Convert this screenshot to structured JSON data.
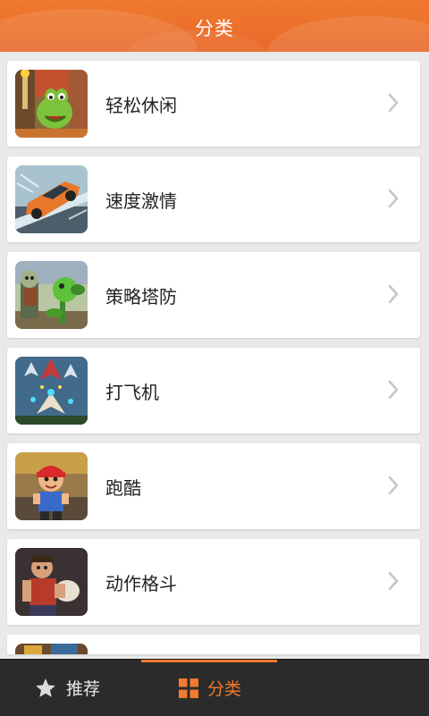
{
  "header": {
    "title": "分类"
  },
  "categories": [
    {
      "label": "轻松休闲",
      "icon": "cut-the-rope-game-icon"
    },
    {
      "label": "速度激情",
      "icon": "racing-car-game-icon"
    },
    {
      "label": "策略塔防",
      "icon": "plants-vs-zombies-game-icon"
    },
    {
      "label": "打飞机",
      "icon": "shooter-planes-game-icon"
    },
    {
      "label": "跑酷",
      "icon": "subway-runner-game-icon"
    },
    {
      "label": "动作格斗",
      "icon": "fighter-game-icon"
    }
  ],
  "bottom_nav": {
    "recommend_label": "推荐",
    "category_label": "分类",
    "active": "分类"
  },
  "colors": {
    "accent": "#f07a2e",
    "background": "#e9e9e9",
    "nav_background": "#2b2b2b"
  }
}
